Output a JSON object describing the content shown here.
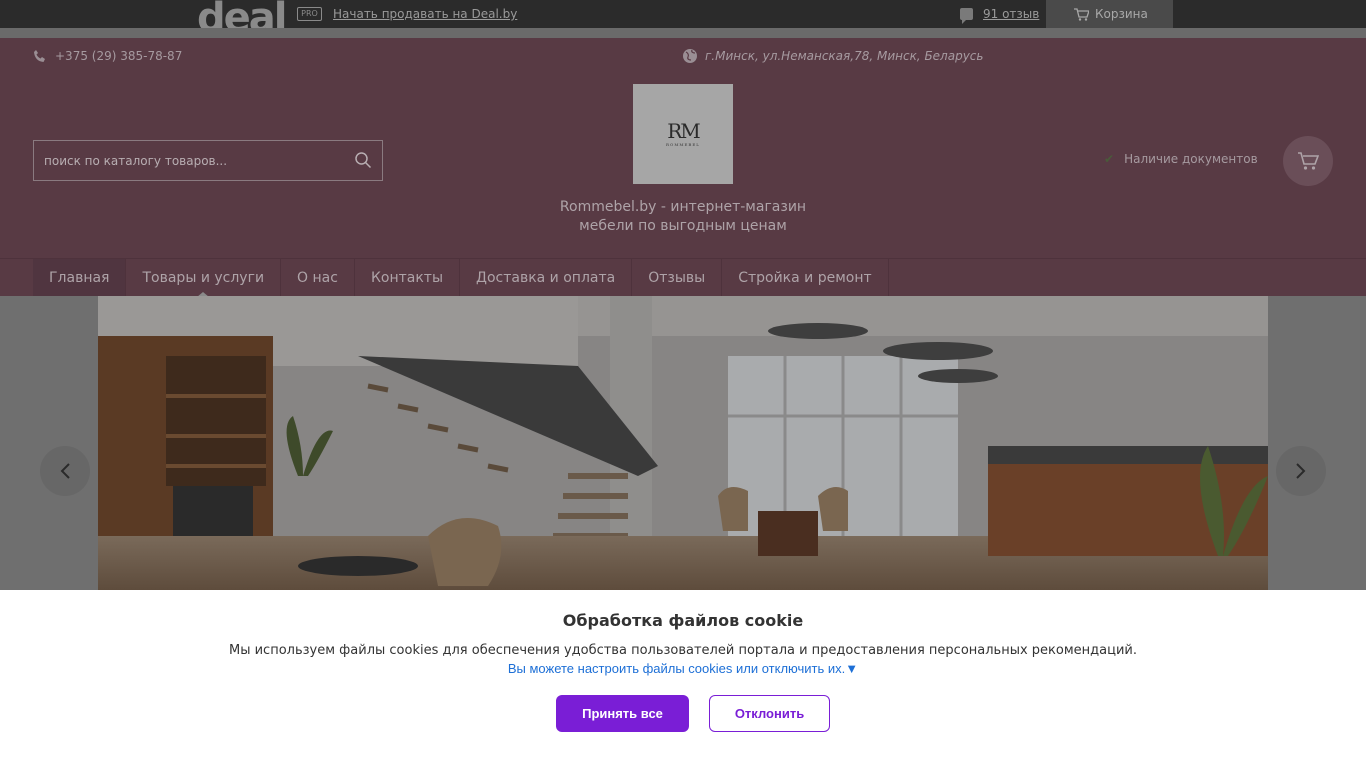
{
  "topbar": {
    "logo_text": "deal",
    "pro_badge": "PRO",
    "sell_link": "Начать продавать на Deal.by",
    "reviews_link": "91 отзыв",
    "cart_label": "Корзина"
  },
  "header": {
    "phone": "+375 (29) 385-78-87",
    "address": "г.Минск, ул.Неманская,78, Минск, Беларусь",
    "search_placeholder": "поиск по каталогу товаров...",
    "logo_mark": "RM",
    "logo_sub": "ROMMEBEL",
    "tagline": "Rommebel.by - интернет-магазин мебели по выгодным ценам",
    "documents_label": "Наличие документов"
  },
  "nav": {
    "items": [
      {
        "label": "Главная"
      },
      {
        "label": "Товары и услуги"
      },
      {
        "label": "О нас"
      },
      {
        "label": "Контакты"
      },
      {
        "label": "Доставка и оплата"
      },
      {
        "label": "Отзывы"
      },
      {
        "label": "Стройка и ремонт"
      }
    ]
  },
  "cookie": {
    "title": "Обработка файлов cookie",
    "text": "Мы используем файлы cookies для обеспечения удобства пользователей портала и предоставления персональных рекомендаций.",
    "settings_link": "Вы можете настроить файлы cookies или отключить их.▼",
    "accept_label": "Принять все",
    "decline_label": "Отклонить"
  },
  "colors": {
    "header_bg": "#583a44",
    "accent_purple": "#7a1ed6",
    "link_blue": "#1d6fd6"
  }
}
